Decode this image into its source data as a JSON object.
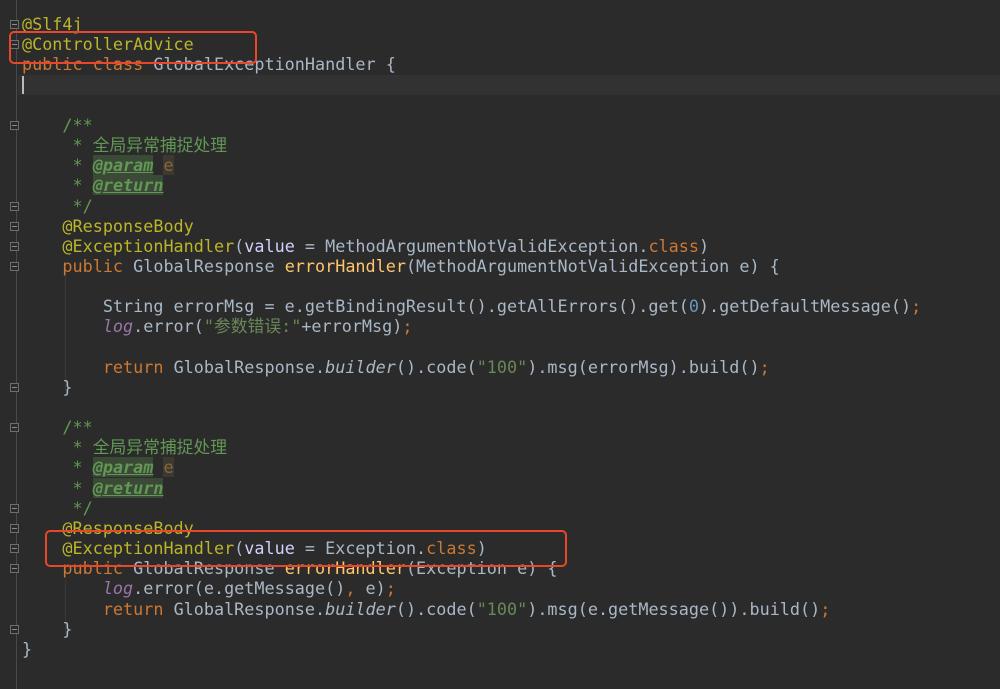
{
  "editor": {
    "colors": {
      "background": "#2b2b2b",
      "annotation": "#bbb529",
      "keyword": "#cc7832",
      "comment": "#629755",
      "highlight_box": "#e8472c"
    },
    "current_line": 4,
    "lines": [
      [],
      [
        [
          "ann",
          "@Slf4j"
        ]
      ],
      [
        [
          "ann",
          "@ControllerAdvice"
        ]
      ],
      [
        [
          "kw",
          "public class "
        ],
        [
          "tx",
          "GlobalExceptionHandler {"
        ]
      ],
      [],
      [],
      [
        [
          "cm",
          "    /**"
        ]
      ],
      [
        [
          "cm",
          "     * 全局异常捕捉处理"
        ]
      ],
      [
        [
          "cm",
          "     * "
        ],
        [
          "tag",
          "@param"
        ],
        [
          "cm",
          " "
        ],
        [
          "pref",
          "e"
        ]
      ],
      [
        [
          "cm",
          "     * "
        ],
        [
          "tag",
          "@return"
        ]
      ],
      [
        [
          "cm",
          "     */"
        ]
      ],
      [
        [
          "ann",
          "    @ResponseBody"
        ]
      ],
      [
        [
          "ann",
          "    @ExceptionHandler"
        ],
        [
          "tx",
          "("
        ],
        [
          "prm",
          "value"
        ],
        [
          "tx",
          " = MethodArgumentNotValidException."
        ],
        [
          "kw",
          "class"
        ],
        [
          "tx",
          ")"
        ]
      ],
      [
        [
          "kw",
          "    public "
        ],
        [
          "tx",
          "GlobalResponse "
        ],
        [
          "fn",
          "errorHandler"
        ],
        [
          "tx",
          "(MethodArgumentNotValidException e) {"
        ]
      ],
      [],
      [
        [
          "tx",
          "        String errorMsg = e.getBindingResult().getAllErrors().get("
        ],
        [
          "num",
          "0"
        ],
        [
          "tx",
          ").getDefaultMessage()"
        ],
        [
          "kw",
          ";"
        ]
      ],
      [
        [
          "log",
          "        log"
        ],
        [
          "tx",
          ".error("
        ],
        [
          "str",
          "\"参数错误:\""
        ],
        [
          "tx",
          "+errorMsg)"
        ],
        [
          "kw",
          ";"
        ]
      ],
      [],
      [
        [
          "kw",
          "        return "
        ],
        [
          "tx",
          "GlobalResponse."
        ],
        [
          "it",
          "builder"
        ],
        [
          "tx",
          "().code("
        ],
        [
          "str",
          "\"100\""
        ],
        [
          "tx",
          ").msg(errorMsg).build()"
        ],
        [
          "kw",
          ";"
        ]
      ],
      [
        [
          "tx",
          "    }"
        ]
      ],
      [],
      [
        [
          "cm",
          "    /**"
        ]
      ],
      [
        [
          "cm",
          "     * 全局异常捕捉处理"
        ]
      ],
      [
        [
          "cm",
          "     * "
        ],
        [
          "tag",
          "@param"
        ],
        [
          "cm",
          " "
        ],
        [
          "pref",
          "e"
        ]
      ],
      [
        [
          "cm",
          "     * "
        ],
        [
          "tag",
          "@return"
        ]
      ],
      [
        [
          "cm",
          "     */"
        ]
      ],
      [
        [
          "ann",
          "    @ResponseBody"
        ]
      ],
      [
        [
          "ann",
          "    @ExceptionHandler"
        ],
        [
          "tx",
          "("
        ],
        [
          "prm",
          "value"
        ],
        [
          "tx",
          " = Exception."
        ],
        [
          "kw",
          "class"
        ],
        [
          "tx",
          ")"
        ]
      ],
      [
        [
          "kw",
          "    public "
        ],
        [
          "tx",
          "GlobalResponse "
        ],
        [
          "fn",
          "errorHandler"
        ],
        [
          "tx",
          "(Exception e) {"
        ]
      ],
      [
        [
          "log",
          "        log"
        ],
        [
          "tx",
          ".error(e.getMessage()"
        ],
        [
          "kw",
          ", "
        ],
        [
          "tx",
          "e)"
        ],
        [
          "kw",
          ";"
        ]
      ],
      [
        [
          "kw",
          "        return "
        ],
        [
          "tx",
          "GlobalResponse."
        ],
        [
          "it",
          "builder"
        ],
        [
          "tx",
          "().code("
        ],
        [
          "str",
          "\"100\""
        ],
        [
          "tx",
          ").msg(e.getMessage()).build()"
        ],
        [
          "kw",
          ";"
        ]
      ],
      [
        [
          "tx",
          "    }"
        ]
      ],
      [
        [
          "tx",
          "}"
        ]
      ]
    ]
  }
}
